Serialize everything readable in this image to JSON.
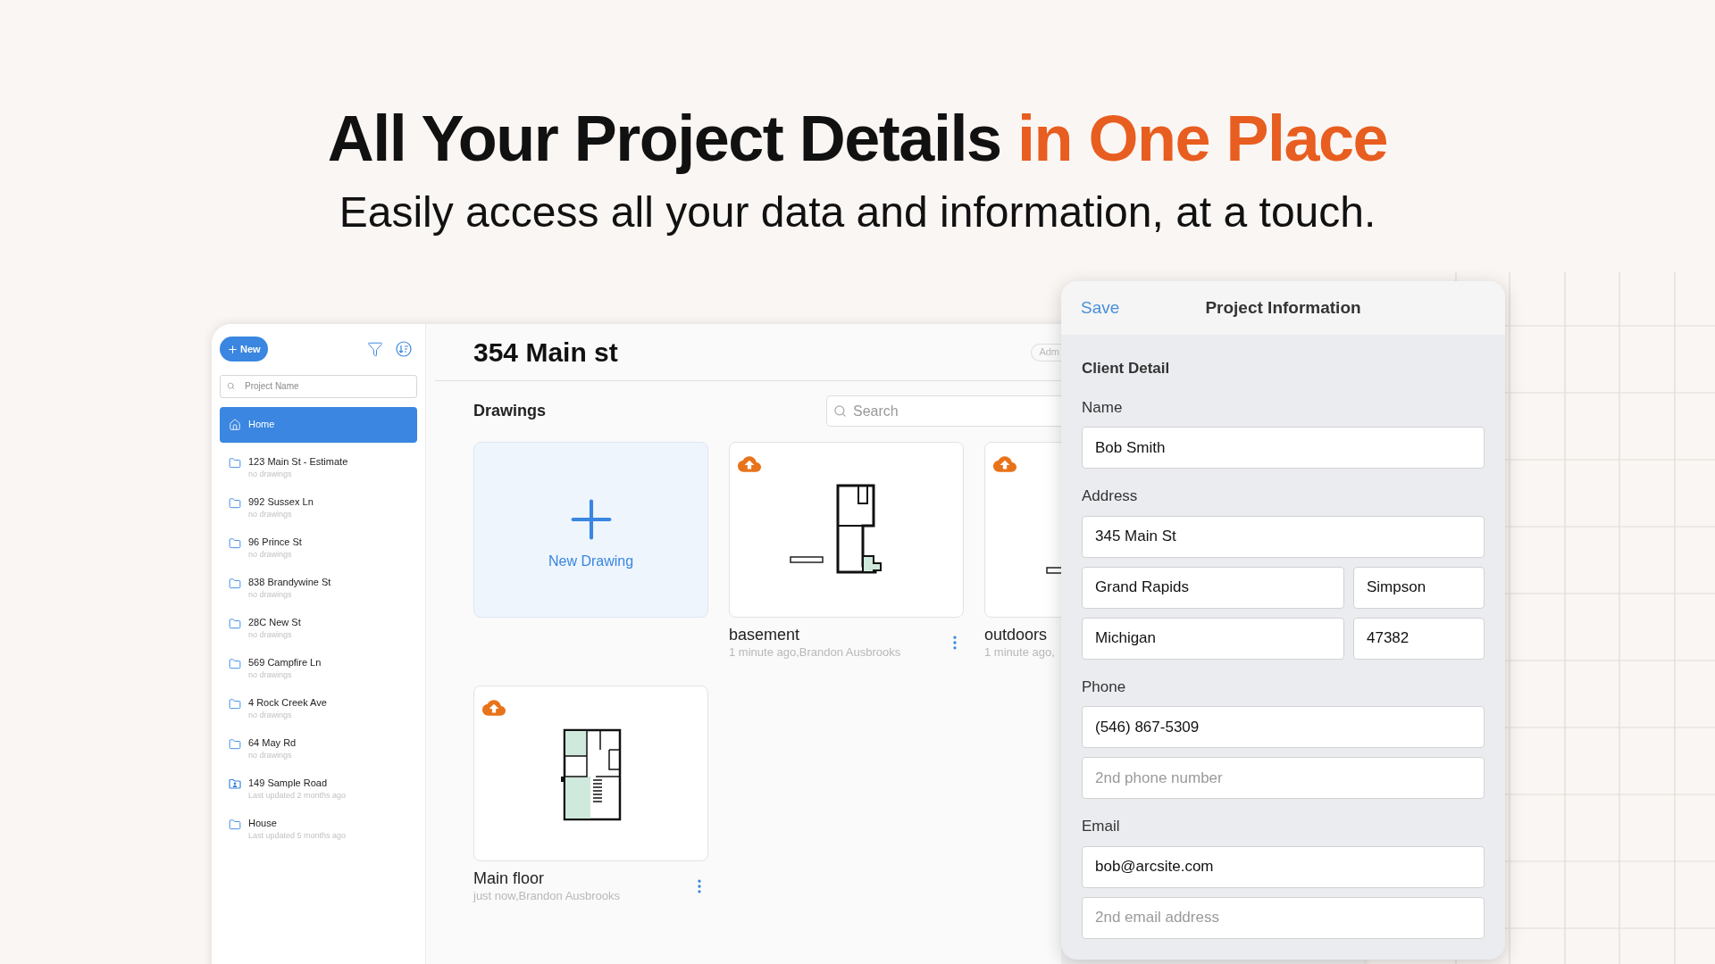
{
  "headline": {
    "text": "All Your Project Details",
    "highlight": "in One Place"
  },
  "subtitle": "Easily access all your data and information, at a touch.",
  "sidebar": {
    "new_button": "New",
    "search": {
      "placeholder": "Project Name"
    },
    "items": [
      {
        "label": "Home",
        "selected": true
      }
    ],
    "projects": [
      {
        "name": "123 Main St - Estimate",
        "detail": "no drawings",
        "kind": "folder"
      },
      {
        "name": "992 Sussex Ln",
        "detail": "no drawings",
        "kind": "folder"
      },
      {
        "name": "96 Prince St",
        "detail": "no drawings",
        "kind": "folder"
      },
      {
        "name": "838 Brandywine St",
        "detail": "no drawings",
        "kind": "folder"
      },
      {
        "name": "28C New St",
        "detail": "no drawings",
        "kind": "folder"
      },
      {
        "name": "569 Campfire Ln",
        "detail": "no drawings",
        "kind": "folder"
      },
      {
        "name": "4 Rock Creek Ave",
        "detail": "no drawings",
        "kind": "folder"
      },
      {
        "name": "64 May Rd",
        "detail": "no drawings",
        "kind": "folder"
      },
      {
        "name": "149 Sample Road",
        "detail": "Last updated 2 months ago",
        "kind": "shared"
      },
      {
        "name": "House",
        "detail": "Last updated 5 months ago",
        "kind": "folder"
      }
    ]
  },
  "main": {
    "title": "354 Main st",
    "badge": "Adm",
    "section": "Drawings",
    "search": {
      "placeholder": "Search"
    },
    "drawings": [
      {
        "kind": "new",
        "label": "New Drawing"
      },
      {
        "kind": "drawing",
        "name": "basement",
        "meta": "1 minute ago,Brandon Ausbrooks"
      },
      {
        "kind": "drawing",
        "name": "outdoors",
        "meta": "1 minute ago,"
      },
      {
        "kind": "drawing",
        "name": "Main floor",
        "meta": "just now,Brandon Ausbrooks"
      }
    ]
  },
  "panel": {
    "save": "Save",
    "title": "Project Information",
    "section": "Client Detail",
    "groups": [
      {
        "label": "Name",
        "rows": [
          [
            {
              "value": "Bob Smith"
            }
          ]
        ]
      },
      {
        "label": "Address",
        "rows": [
          [
            {
              "value": "345 Main St"
            }
          ],
          [
            {
              "value": "Grand Rapids"
            },
            {
              "value": "Simpson"
            }
          ],
          [
            {
              "value": "Michigan"
            },
            {
              "value": "47382"
            }
          ]
        ]
      },
      {
        "label": "Phone",
        "rows": [
          [
            {
              "value": "(546) 867-5309"
            }
          ],
          [
            {
              "placeholder": "2nd phone number"
            }
          ]
        ]
      },
      {
        "label": "Email",
        "rows": [
          [
            {
              "value": "bob@arcsite.com"
            }
          ],
          [
            {
              "placeholder": "2nd email address"
            }
          ]
        ]
      }
    ]
  }
}
